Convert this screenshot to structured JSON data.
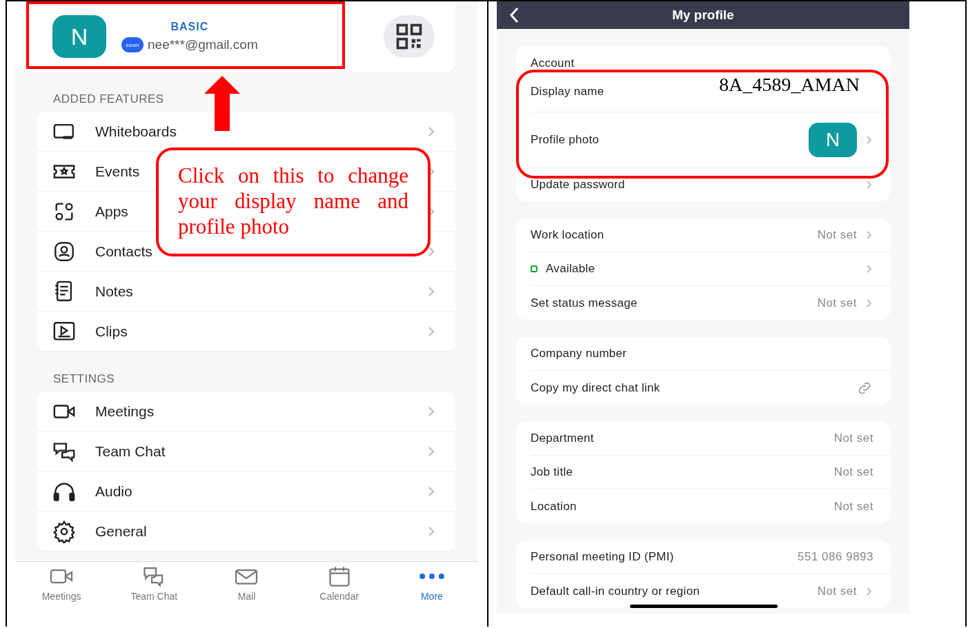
{
  "left_screen": {
    "profile": {
      "avatar_letter": "N",
      "plan": "BASIC",
      "logo_text": "zoom",
      "email": "nee***@gmail.com"
    },
    "sections": [
      {
        "title": "ADDED FEATURES",
        "items": [
          {
            "label": "Whiteboards",
            "chevron": true
          },
          {
            "label": "Events",
            "chevron": true
          },
          {
            "label": "Apps",
            "chevron": true
          },
          {
            "label": "Contacts",
            "chevron": true
          },
          {
            "label": "Notes",
            "chevron": true
          },
          {
            "label": "Clips",
            "chevron": true
          }
        ]
      },
      {
        "title": "SETTINGS",
        "items": [
          {
            "label": "Meetings",
            "chevron": true
          },
          {
            "label": "Team Chat",
            "chevron": true
          },
          {
            "label": "Audio",
            "chevron": true
          },
          {
            "label": "General",
            "chevron": true
          }
        ]
      }
    ],
    "tabs": [
      {
        "label": "Meetings",
        "selected": false
      },
      {
        "label": "Team Chat",
        "selected": false
      },
      {
        "label": "Mail",
        "selected": false
      },
      {
        "label": "Calendar",
        "selected": false
      },
      {
        "label": "More",
        "selected": true
      }
    ],
    "callout": {
      "text": "Click on this to change your display name and profile photo"
    }
  },
  "right_screen": {
    "header": {
      "title": "My profile"
    },
    "cards": [
      {
        "rows": [
          {
            "kind": "cut",
            "label": "Account",
            "chevron": false
          },
          {
            "kind": "pasted",
            "label": "Display name",
            "value": "8A_4589_AMAN",
            "chevron": false
          },
          {
            "kind": "avatar",
            "label": "Profile photo",
            "value": "N",
            "chevron": true
          },
          {
            "kind": "text",
            "label": "Update password",
            "chevron": true
          }
        ]
      },
      {
        "rows": [
          {
            "kind": "text",
            "label": "Work location",
            "value": "Not set",
            "chevron": true
          },
          {
            "kind": "status",
            "label": "Available",
            "chevron": true
          },
          {
            "kind": "text",
            "label": "Set status message",
            "value": "Not set",
            "chevron": true
          }
        ]
      },
      {
        "rows": [
          {
            "kind": "text",
            "label": "Company number",
            "chevron": false
          },
          {
            "kind": "link",
            "label": "Copy my direct chat link",
            "chevron": false
          }
        ]
      },
      {
        "rows": [
          {
            "kind": "text",
            "label": "Department",
            "value": "Not set",
            "chevron": false
          },
          {
            "kind": "text",
            "label": "Job title",
            "value": "Not set",
            "chevron": false
          },
          {
            "kind": "text",
            "label": "Location",
            "value": "Not set",
            "chevron": false
          }
        ]
      },
      {
        "rows": [
          {
            "kind": "text",
            "label": "Personal meeting ID (PMI)",
            "value": "551 086 9893",
            "chevron": false
          },
          {
            "kind": "text",
            "label": "Default call-in country or region",
            "value": "Not set",
            "chevron": true
          }
        ]
      }
    ]
  }
}
